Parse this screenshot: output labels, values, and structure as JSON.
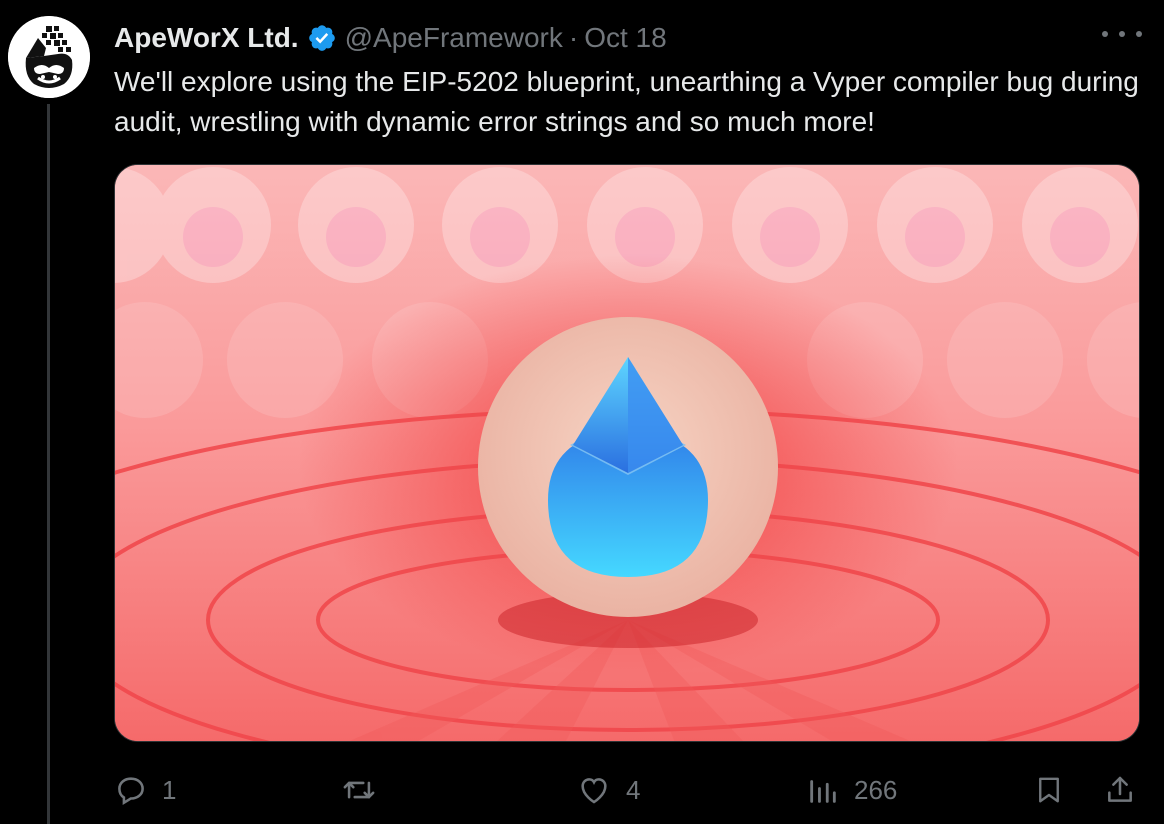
{
  "tweet": {
    "author_name": "ApeWorX Ltd.",
    "handle": "@ApeFramework",
    "separator": "·",
    "date": "Oct 18",
    "text": "We'll explore using the EIP-5202 blueprint, unearthing a Vyper compiler bug during audit, wrestling with dynamic error strings and so much more!",
    "verified": true,
    "avatar_icon": "gorilla-logo-icon",
    "media_description_icons": [
      "ethereum-droplet-icon"
    ]
  },
  "actions": {
    "reply_count": "1",
    "retweet_count": "",
    "like_count": "4",
    "views_count": "266"
  },
  "colors": {
    "background": "#000000",
    "text_primary": "#e7e9ea",
    "text_secondary": "#71767b",
    "verified_blue": "#1d9bf0",
    "media_red": "#f87d7d"
  }
}
